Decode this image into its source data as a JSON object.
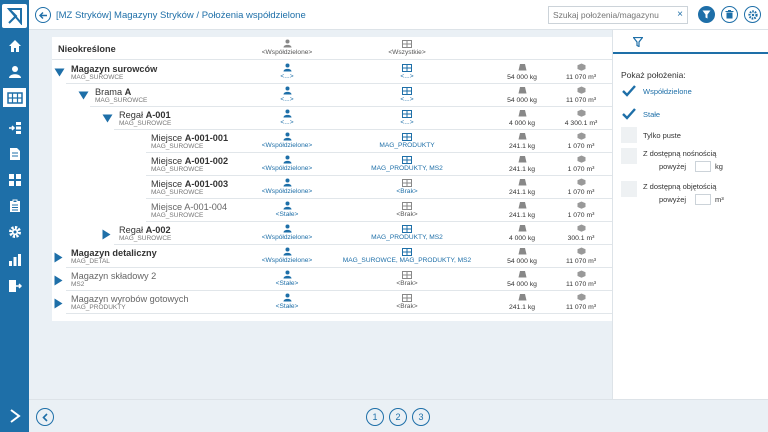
{
  "header": {
    "title": "[MZ Stryków] Magazyny Stryków / Położenia współdzielone",
    "search_placeholder": "Szukaj położenia/magazynu",
    "clear": "×"
  },
  "tree": {
    "header_row": {
      "name": "Nieokreślone",
      "shared": "<Współdzielone>",
      "zones": "<Wszystkie>"
    },
    "rows": [
      {
        "id": "ms",
        "name_prefix": "",
        "name_bold": "Magazyn surowców",
        "code": "MAG_SUROWCE",
        "shared": "<...>",
        "zones": "<...>",
        "weight": "54 000 kg",
        "volume": "11 070 m³",
        "expander": "down"
      },
      {
        "id": "br",
        "name_prefix": "Brama",
        "name_bold": "A",
        "code": "MAG_SUROWCE",
        "shared": "<...>",
        "zones": "<...>",
        "weight": "54 000 kg",
        "volume": "11 070 m³",
        "expander": "down"
      },
      {
        "id": "ra1",
        "name_prefix": "Regał",
        "name_bold": "A-001",
        "code": "MAG_SUROWCE",
        "shared": "<...>",
        "zones": "<...>",
        "weight": "4 000 kg",
        "volume": "4 300.1 m³",
        "expander": "down"
      },
      {
        "id": "m1",
        "name_prefix": "Miejsce",
        "name_bold": "A-001-001",
        "code": "MAG_SUROWCE",
        "shared": "<Współdzielone>",
        "zones": "MAG_PRODUKTY",
        "weight": "241.1 kg",
        "volume": "1 070 m³"
      },
      {
        "id": "m2",
        "name_prefix": "Miejsce",
        "name_bold": "A-001-002",
        "code": "MAG_SUROWCE",
        "shared": "<Współdzielone>",
        "zones": "MAG_PRODUKTY, MS2",
        "weight": "241.1 kg",
        "volume": "1 070 m³"
      },
      {
        "id": "m3",
        "name_prefix": "Miejsce",
        "name_bold": "A-001-003",
        "code": "MAG_SUROWCE",
        "shared": "<Współdzielone>",
        "zones": "<Brak>",
        "weight": "241.1 kg",
        "volume": "1 070 m³"
      },
      {
        "id": "m4",
        "name_prefix": "Miejsce",
        "name_bold": "A-001-004",
        "code": "MAG_SUROWCE",
        "shared": "<Stałe>",
        "zones": "<Brak>",
        "weight": "241.1 kg",
        "volume": "1 070 m³"
      },
      {
        "id": "ra2",
        "name_prefix": "Regał",
        "name_bold": "A-002",
        "code": "MAG_SUROWCE",
        "shared": "<Współdzielone>",
        "zones": "MAG_PRODUKTY, MS2",
        "weight": "4 000 kg",
        "volume": "300.1 m³",
        "expander": "right"
      },
      {
        "id": "md",
        "name_prefix": "",
        "name_bold": "Magazyn detaliczny",
        "code": "MAG_DETAL",
        "shared": "<Współdzielone>",
        "zones": "MAG_SUROWCE, MAG_PRODUKTY, MS2",
        "weight": "54 000 kg",
        "volume": "11 070 m³",
        "expander": "right"
      },
      {
        "id": "mk",
        "name_prefix": "Magazyn składowy 2",
        "name_bold": "",
        "code": "MS2",
        "shared": "<Stałe>",
        "zones": "<Brak>",
        "weight": "54 000 kg",
        "volume": "11 070 m³",
        "expander": "right"
      },
      {
        "id": "mw",
        "name_prefix": "Magazyn wyrobów gotowych",
        "name_bold": "",
        "code": "MAG_PRODUKTY",
        "shared": "<Stałe>",
        "zones": "<Brak>",
        "weight": "241.1 kg",
        "volume": "11 070 m³",
        "expander": "right"
      }
    ]
  },
  "filter_panel": {
    "title": "Pokaż położenia:",
    "opt_shared": "Współdzielone",
    "opt_fixed": "Stałe",
    "opt_empty": "Tylko puste",
    "opt_capacity_line1": "Z dostępną nośnością",
    "opt_capacity_line2": "powyżej",
    "opt_capacity_unit": "kg",
    "opt_volume_line1": "Z dostępną objętością",
    "opt_volume_line2": "powyżej",
    "opt_volume_unit": "m³"
  },
  "pagination": {
    "p1": "1",
    "p2": "2",
    "p3": "3"
  },
  "colors": {
    "accent": "#1e6fa8",
    "background": "#eaf0f5"
  }
}
